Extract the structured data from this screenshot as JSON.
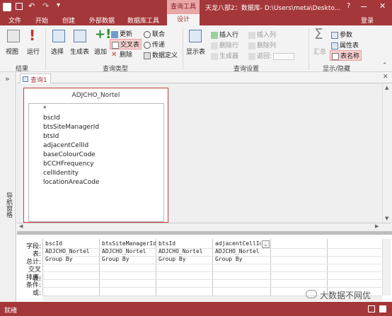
{
  "titlebar": {
    "context_tab": "查询工具",
    "title": "天龙八部2：数据库- D:\\Users\\meta\\Deskto...",
    "help": "?"
  },
  "ribbon_tabs": {
    "file": "文件",
    "home": "开始",
    "create": "创建",
    "external_data": "外部数据",
    "db_tools": "数据库工具",
    "design": "设计",
    "login": "登录"
  },
  "ribbon": {
    "view": "视图",
    "run": "运行",
    "group_results": "结果",
    "select": "选择",
    "make_table": "生成表",
    "append": "追加",
    "update": "更新",
    "crosstab": "交叉表",
    "delete": "删除",
    "union": "联合",
    "pass_through": "传递",
    "data_definition": "数据定义",
    "group_query_type": "查询类型",
    "show_table": "显示表",
    "insert_rows": "插入行",
    "delete_rows": "删除行",
    "builder": "生成器",
    "insert_cols": "插入列",
    "delete_cols": "删除列",
    "return": "返回:",
    "group_query_setup": "查询设置",
    "totals": "汇总",
    "parameters": "参数",
    "property_sheet": "属性表",
    "table_names": "表名称",
    "group_show_hide": "显示/隐藏"
  },
  "nav": {
    "toggle": "»",
    "label": "导航窗格"
  },
  "doc_tab": {
    "label": "查询1"
  },
  "table": {
    "name": "ADJCHO_Nortel",
    "fields": [
      "*",
      "bscId",
      "btsSiteManagerId",
      "btsId",
      "adjacentCellId",
      "baseColourCode",
      "bCCHFrequency",
      "cellIdentity",
      "locationAreaCode"
    ]
  },
  "grid": {
    "row_labels": [
      "字段:",
      "表:",
      "总计:",
      "交叉表:",
      "排序:",
      "条件:",
      "或:"
    ],
    "columns": [
      {
        "field": "bscId",
        "table": "ADJCHO_Nortel",
        "total": "Group By"
      },
      {
        "field": "btsSiteManagerId",
        "table": "ADJCHO_Nortel",
        "total": "Group By"
      },
      {
        "field": "btsId",
        "table": "ADJCHO_Nortel",
        "total": "Group By"
      },
      {
        "field": "adjacentCellId",
        "table": "ADJCHO_Nortel",
        "total": "Group By"
      }
    ]
  },
  "status": {
    "text": "就绪",
    "watermark": "大数据不网优"
  },
  "colors": {
    "accent": "#a4373a",
    "context": "#e9a6a6",
    "selected_table_border": "#c73a3a"
  }
}
